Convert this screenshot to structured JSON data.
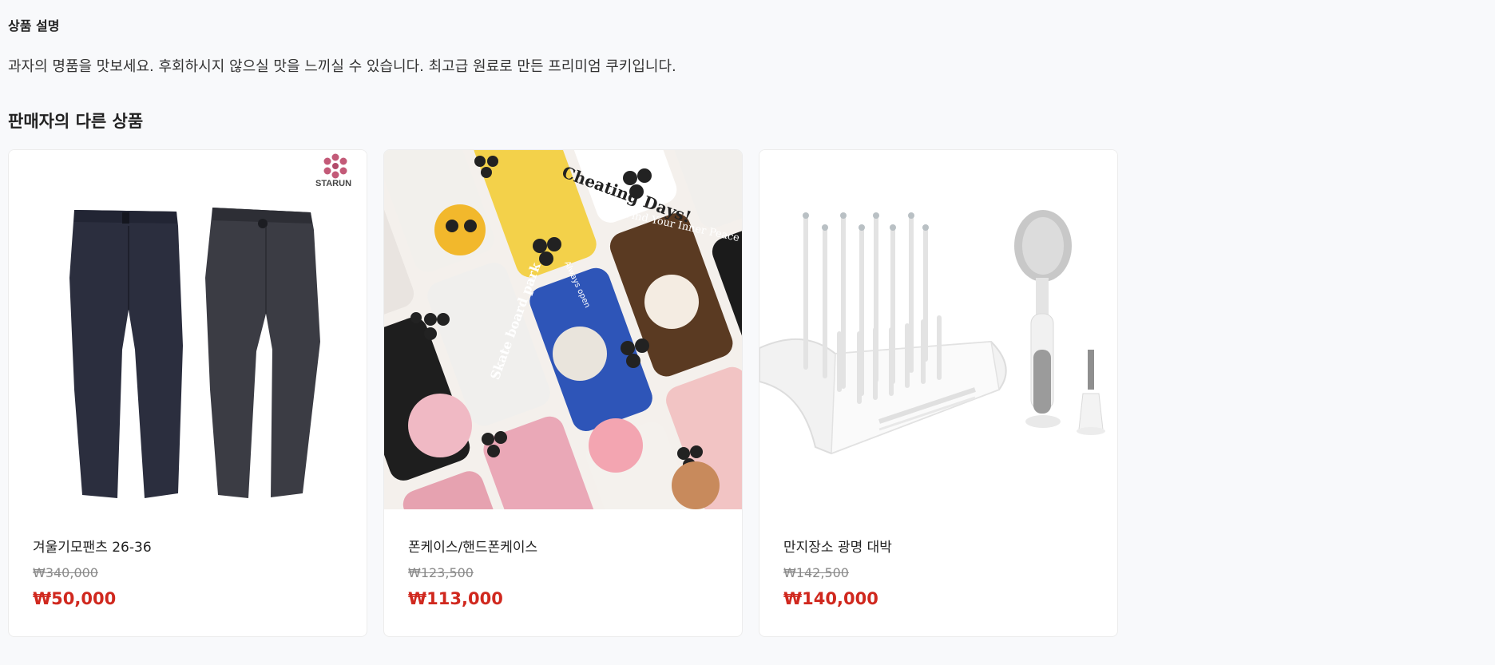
{
  "description": {
    "title": "상품 설명",
    "text": "과자의 명품을 맛보세요. 후회하시지 않으실 맛을 느끼실 수 있습니다. 최고급 원료로 만든 프리미엄 쿠키입니다."
  },
  "other_products": {
    "title": "판매자의 다른 상품",
    "items": [
      {
        "name": "겨울기모팬츠 26-36",
        "original_price": "₩340,000",
        "price": "₩50,000",
        "image": "two pairs of navy and charcoal dress pants with brand logo",
        "logo_text": "STARUN"
      },
      {
        "name": "폰케이스/핸드폰케이스",
        "original_price": "₩123,500",
        "price": "₩113,000",
        "image": "grid of illustrated phone cases with bear and tiger characters",
        "case_texts": [
          "Cheating Days!",
          "Find Your Inner Peace at Campsite",
          "Skate board park",
          "Always open"
        ]
      },
      {
        "name": "만지장소 광명 대박",
        "original_price": "₩142,500",
        "price": "₩140,000",
        "image": "white baby bottle drying rack with bottle brush"
      }
    ]
  },
  "colors": {
    "accent_price": "#d0281e",
    "background": "#f8f9fb"
  }
}
